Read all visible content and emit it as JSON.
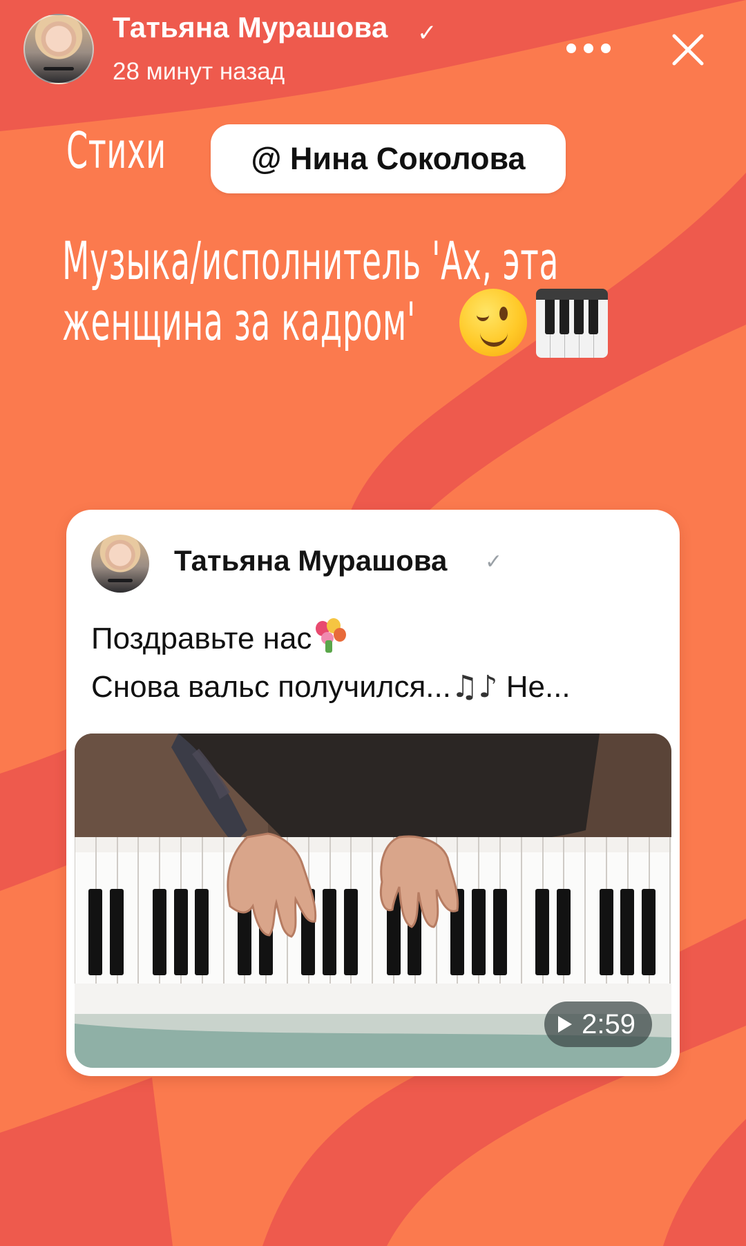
{
  "header": {
    "author_name": "Татьяна Мурашова",
    "verified_icon": "✓",
    "time_ago": "28 минут назад",
    "more_icon": "more-dots-icon",
    "close_icon": "close-icon"
  },
  "story": {
    "category_label": "Стихи",
    "mention": "@ Нина Соколова",
    "headline_lines": [
      "Музыка/исполнитель 'Ах, эта",
      "женщина за кадром'"
    ],
    "headline_emojis": [
      "winking-face-emoji",
      "piano-keys-emoji"
    ]
  },
  "shared_post": {
    "author_name": "Татьяна Мурашова",
    "verified_icon": "✓",
    "text_line_1": "Поздравьте нас",
    "text_line_2_start": "Снова вальс получился...",
    "notes": "♫♪",
    "text_line_2_end": " Не...",
    "video_duration": "2:59"
  },
  "colors": {
    "background": "#fb7a4e",
    "background_stripe": "#ee5a4d",
    "card": "#ffffff"
  }
}
